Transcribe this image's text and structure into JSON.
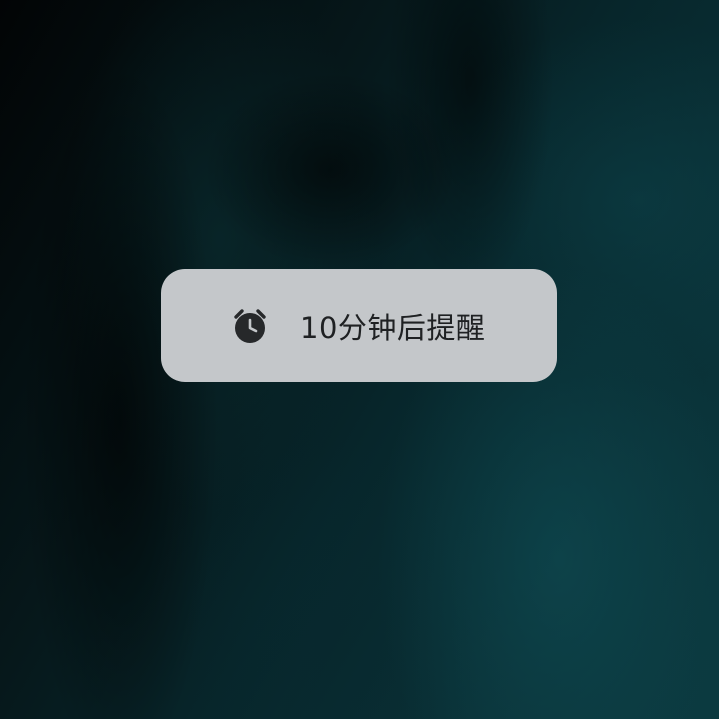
{
  "toast": {
    "icon": "alarm-clock-icon",
    "message": "10分钟后提醒"
  },
  "colors": {
    "toast_background": "#c4c7ca",
    "toast_text": "#1f2123",
    "icon": "#26282a",
    "wallpaper_dark": "#020405",
    "wallpaper_teal": "#0b3a40"
  }
}
